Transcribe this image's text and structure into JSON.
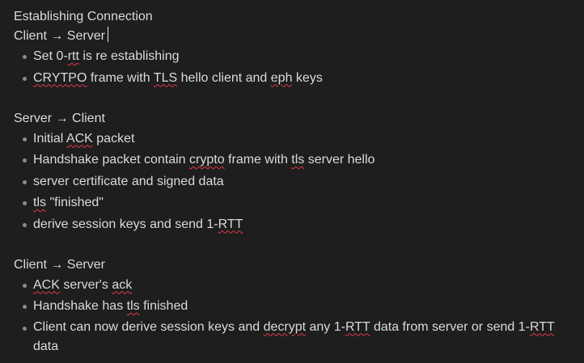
{
  "title": "Establishing Connection",
  "sections": [
    {
      "heading": "Client → Server",
      "items": [
        {
          "parts": [
            {
              "t": "Set 0-"
            },
            {
              "t": "rtt",
              "s": true
            },
            {
              "t": " is re establishing"
            }
          ]
        },
        {
          "parts": [
            {
              "t": "CRYTPO",
              "s": true
            },
            {
              "t": " frame with "
            },
            {
              "t": "TLS",
              "s": true
            },
            {
              "t": " hello client and "
            },
            {
              "t": "eph",
              "s": true
            },
            {
              "t": " keys"
            }
          ]
        }
      ]
    },
    {
      "heading": "Server → Client",
      "items": [
        {
          "parts": [
            {
              "t": "Initial "
            },
            {
              "t": "ACK",
              "s": true
            },
            {
              "t": " packet"
            }
          ]
        },
        {
          "parts": [
            {
              "t": "Handshake packet contain "
            },
            {
              "t": "crypto",
              "s": true
            },
            {
              "t": " frame with "
            },
            {
              "t": "tls",
              "s": true
            },
            {
              "t": " server hello"
            }
          ]
        },
        {
          "parts": [
            {
              "t": "server certificate and signed data"
            }
          ]
        },
        {
          "parts": [
            {
              "t": "tls",
              "s": true
            },
            {
              "t": " \"finished\""
            }
          ]
        },
        {
          "parts": [
            {
              "t": "derive session keys and send 1-"
            },
            {
              "t": "RTT",
              "s": true
            }
          ]
        }
      ]
    },
    {
      "heading": "Client → Server",
      "items": [
        {
          "parts": [
            {
              "t": "ACK",
              "s": true
            },
            {
              "t": " server's "
            },
            {
              "t": "ack",
              "s": true
            }
          ]
        },
        {
          "parts": [
            {
              "t": "Handshake has "
            },
            {
              "t": "tls",
              "s": true
            },
            {
              "t": " finished"
            }
          ]
        },
        {
          "parts": [
            {
              "t": "Client can now derive session keys and "
            },
            {
              "t": "decrypt",
              "s": true
            },
            {
              "t": " any 1-"
            },
            {
              "t": "RTT",
              "s": true
            },
            {
              "t": " data from server or send 1-"
            },
            {
              "t": "RTT",
              "s": true
            },
            {
              "t": " data"
            }
          ],
          "wrap": true
        }
      ]
    }
  ]
}
